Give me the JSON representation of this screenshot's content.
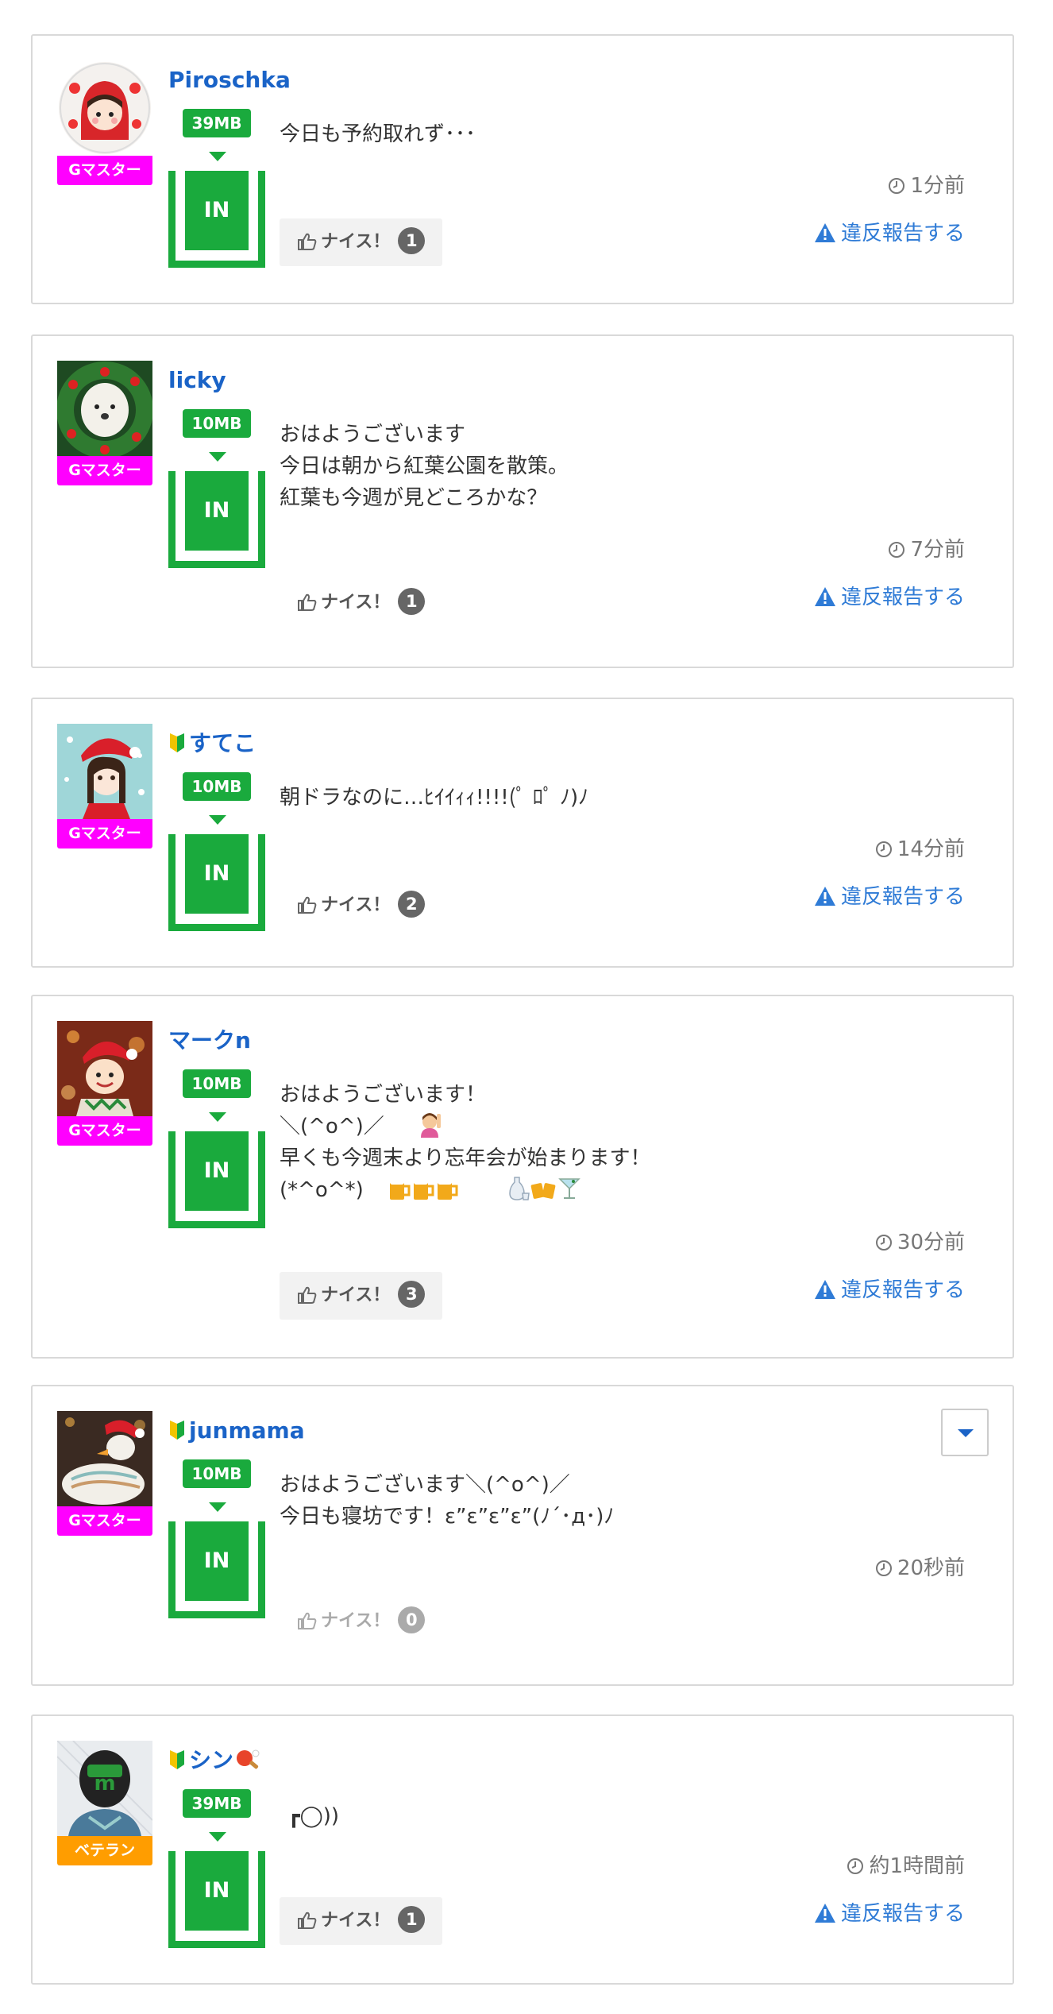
{
  "colors": {
    "username": "#1a63c7",
    "badge_green": "#1aaa3d",
    "rank_master": "#ff00ff",
    "rank_veteran": "#ff9d00",
    "report_link": "#2f7bd6"
  },
  "posts": [
    {
      "username": "Piroschka",
      "beginner": false,
      "rank": "Gマスター",
      "data_badge": "39MB",
      "in_label": "IN",
      "message": [
        "今日も予約取れず･･･"
      ],
      "time": "1分前",
      "nice_label": "ナイス！",
      "nice_count": "1",
      "report_label": "違反報告する",
      "avatar_icon": "red-riding-hood-avatar"
    },
    {
      "username": "licky",
      "beginner": false,
      "rank": "Gマスター",
      "data_badge": "10MB",
      "in_label": "IN",
      "message": [
        "おはようございます",
        "今日は朝から紅葉公園を散策。",
        "紅葉も今週が見どころかな？"
      ],
      "time": "7分前",
      "nice_label": "ナイス！",
      "nice_count": "1",
      "report_label": "違反報告する",
      "avatar_icon": "white-dog-wreath-avatar"
    },
    {
      "username": "すてこ",
      "beginner": true,
      "rank": "Gマスター",
      "data_badge": "10MB",
      "in_label": "IN",
      "message": [
        "朝ドラなのに…ﾋｲｲｨｨ!!!!(ﾟ ﾛﾟ ﾉ)ﾉ"
      ],
      "time": "14分前",
      "nice_label": "ナイス！",
      "nice_count": "2",
      "report_label": "違反報告する",
      "avatar_icon": "santa-girl-avatar"
    },
    {
      "username": "マークn",
      "beginner": false,
      "rank": "Gマスター",
      "data_badge": "10MB",
      "in_label": "IN",
      "message": [
        "おはようございます！",
        "＼(^o^)／",
        "早くも今週末より忘年会が始まります！",
        "(*^o^*)"
      ],
      "time": "30分前",
      "nice_label": "ナイス！",
      "nice_count": "3",
      "report_label": "違反報告する",
      "avatar_icon": "santa-boy-avatar"
    },
    {
      "username": "junmama",
      "beginner": true,
      "rank": "Gマスター",
      "data_badge": "10MB",
      "in_label": "IN",
      "message": [
        "おはようございます＼(^o^)／",
        "今日も寝坊です！ε”ε”ε”ε”(ﾉ´･д･)ﾉ"
      ],
      "time": "20秒前",
      "nice_label": "ナイス！",
      "nice_count": "0",
      "report_label": "",
      "avatar_icon": "swan-santa-avatar"
    },
    {
      "username": "シン",
      "beginner": true,
      "rank": "ベテラン",
      "data_badge": "39MB",
      "in_label": "IN",
      "message": [
        "┏◯))"
      ],
      "time": "約1時間前",
      "nice_label": "ナイス！",
      "nice_count": "1",
      "report_label": "違反報告する",
      "avatar_icon": "masked-rider-avatar"
    }
  ]
}
